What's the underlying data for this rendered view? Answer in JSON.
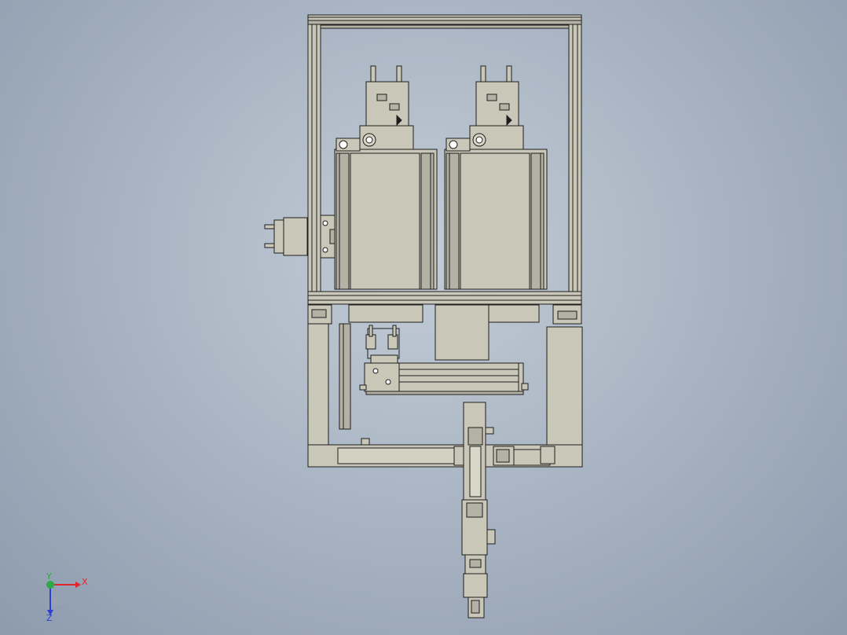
{
  "viewport": {
    "background_center": "#c3ccd7",
    "background_edge": "#8d9bad"
  },
  "model": {
    "part_fill": "#c8c7b8",
    "part_fill_dark": "#b3b2a4",
    "edge_color": "#1e1e1e"
  },
  "triad": {
    "x_label": "X",
    "y_label": "Y",
    "z_label": "Z",
    "x_color": "#e0262a",
    "y_color": "#2fa84a",
    "z_color": "#2a3fd6"
  }
}
